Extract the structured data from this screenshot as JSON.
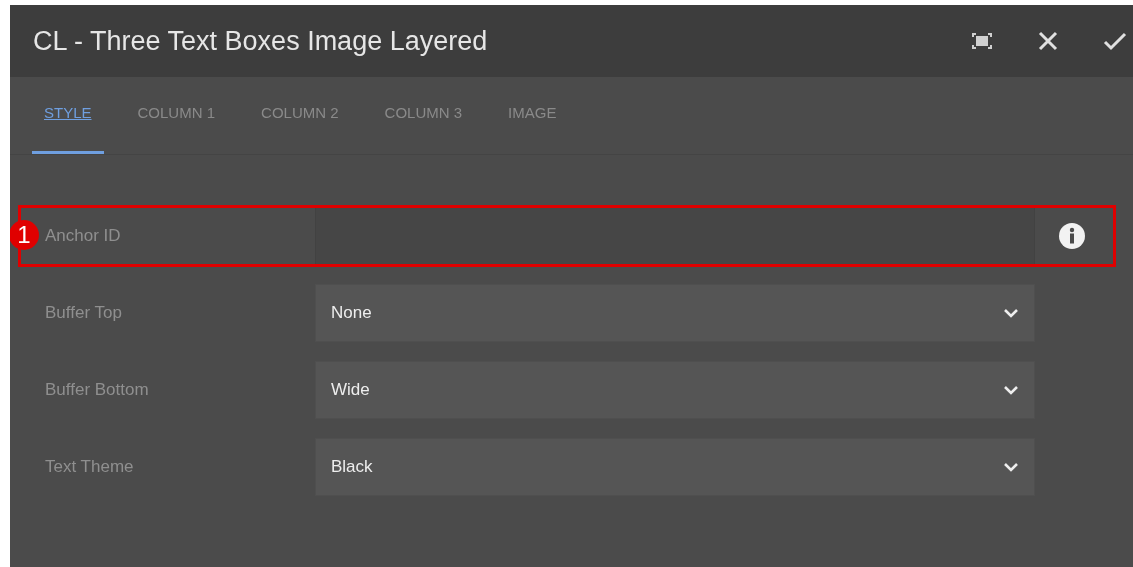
{
  "window": {
    "title": "CL - Three Text Boxes Image Layered"
  },
  "tabs": [
    {
      "label": "STYLE",
      "selected": true
    },
    {
      "label": "COLUMN 1",
      "selected": false
    },
    {
      "label": "COLUMN 2",
      "selected": false
    },
    {
      "label": "COLUMN 3",
      "selected": false
    },
    {
      "label": "IMAGE",
      "selected": false
    }
  ],
  "fields": [
    {
      "kind": "text",
      "label": "Anchor ID",
      "callout": "1"
    },
    {
      "kind": "select",
      "label": "Buffer Top",
      "value": "None"
    },
    {
      "kind": "select",
      "label": "Buffer Bottom",
      "value": "Wide"
    },
    {
      "kind": "select",
      "label": "Text Theme",
      "value": "Black"
    }
  ]
}
